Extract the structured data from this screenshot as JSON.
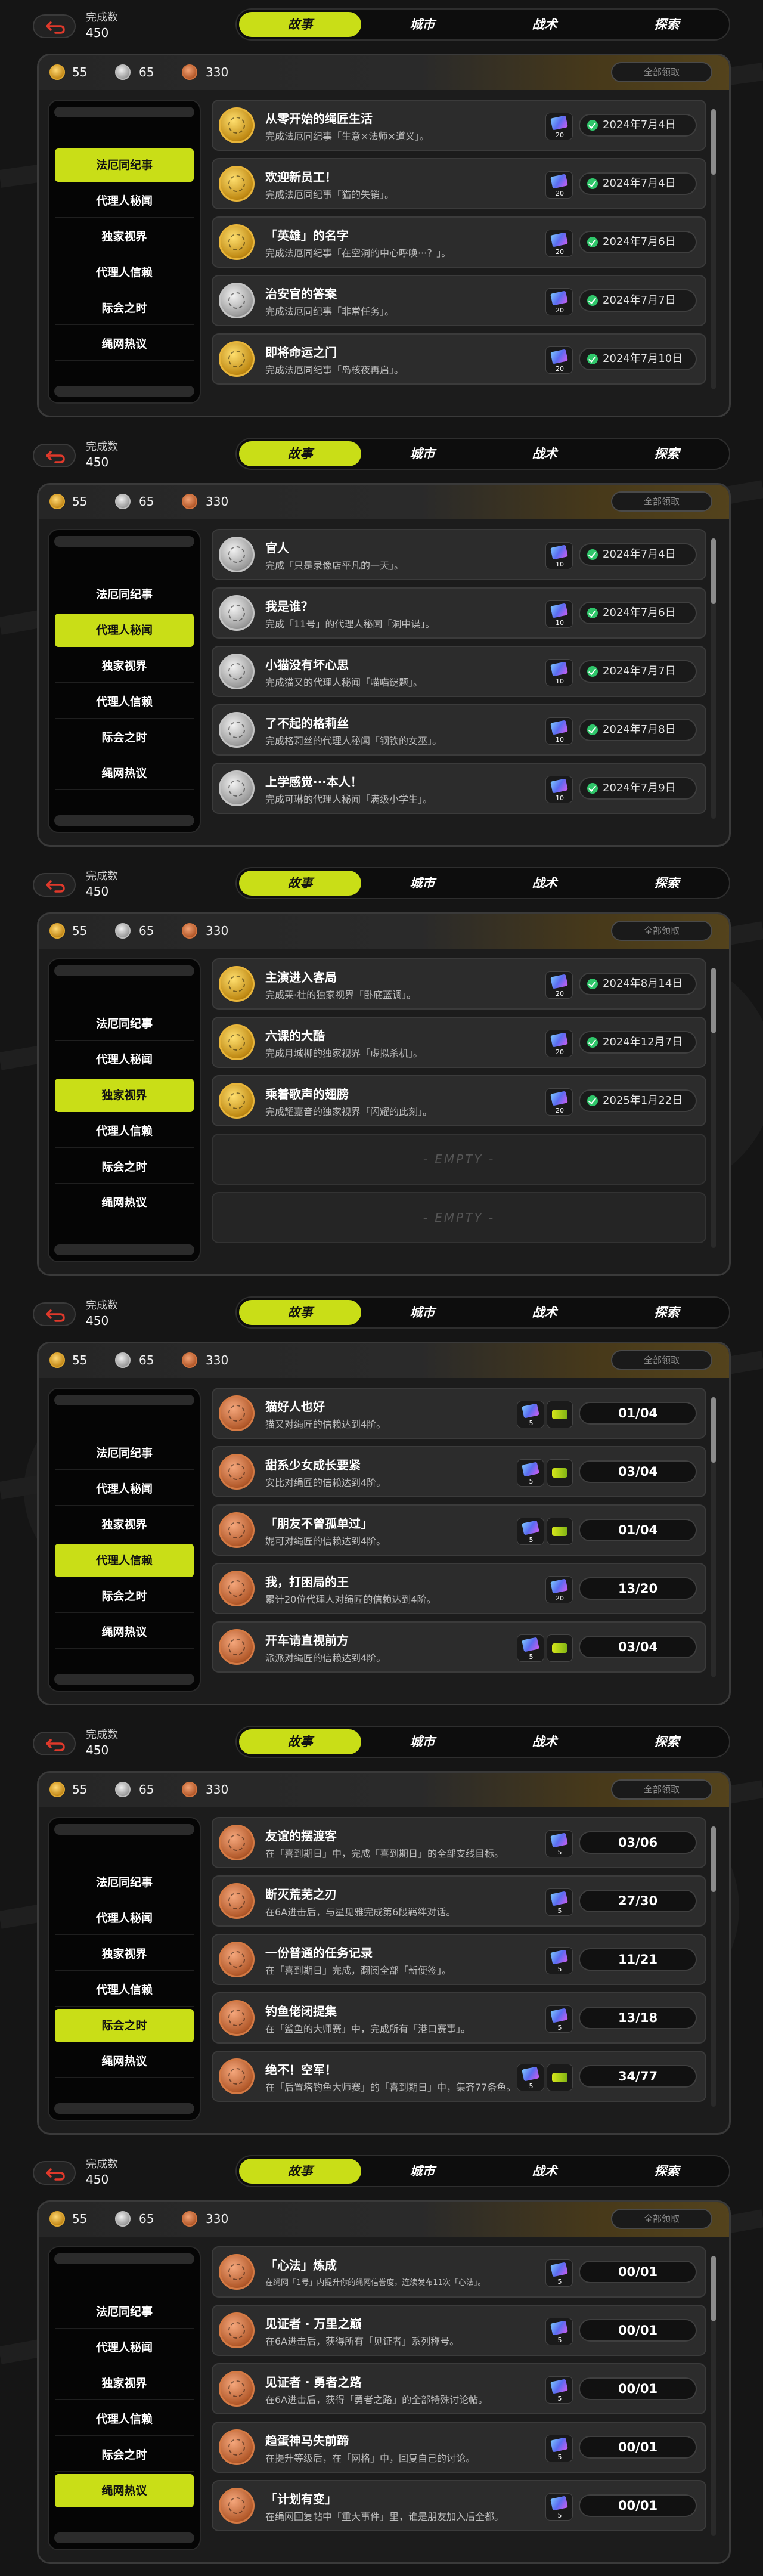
{
  "colors": {
    "accent": "#c9de17",
    "background": "#151515",
    "panel": "#1c1c1c",
    "row": "#2c2c2c",
    "check": "#2fc66a"
  },
  "icons": {
    "back": "back-arrow-icon",
    "coin_gold": "gold-coin-icon",
    "coin_silver": "silver-coin-icon",
    "coin_bronze": "bronze-coin-icon",
    "ticket": "film-ticket-icon",
    "chip": "chip-icon",
    "check": "check-icon",
    "medal": "medal-icon"
  },
  "screens": [
    {
      "count_label": "完成数",
      "count_value": "450",
      "tabs": [
        "故事",
        "城市",
        "战术",
        "探索"
      ],
      "active_tab": 0,
      "coins": {
        "gold": "55",
        "silver": "65",
        "bronze": "330"
      },
      "claim_all": "全部领取",
      "sidebar": [
        "法厄同纪事",
        "代理人秘闻",
        "独家视界",
        "代理人信赖",
        "际会之时",
        "绳网热议"
      ],
      "active_sidebar": 0,
      "rows": [
        {
          "medal": "gold",
          "title": "从零开始的绳匠生活",
          "desc": "完成法厄同纪事「生意×法师×道义」。",
          "ticket": "20",
          "chip": "",
          "status": "date",
          "value": "2024年7月4日"
        },
        {
          "medal": "gold",
          "title": "欢迎新员工！",
          "desc": "完成法厄同纪事「猫的失销」。",
          "ticket": "20",
          "chip": "",
          "status": "date",
          "value": "2024年7月4日"
        },
        {
          "medal": "gold",
          "title": "「英雄」的名字",
          "desc": "完成法厄同纪事「在空洞的中心呼唤···？」。",
          "ticket": "20",
          "chip": "",
          "status": "date",
          "value": "2024年7月6日"
        },
        {
          "medal": "silver",
          "title": "治安官的答案",
          "desc": "完成法厄同纪事「非常任务」。",
          "ticket": "20",
          "chip": "",
          "status": "date",
          "value": "2024年7月7日"
        },
        {
          "medal": "gold",
          "title": "即将命运之门",
          "desc": "完成法厄同纪事「岛核夜再启」。",
          "ticket": "20",
          "chip": "",
          "status": "date",
          "value": "2024年7月10日"
        }
      ],
      "empty": []
    },
    {
      "count_label": "完成数",
      "count_value": "450",
      "tabs": [
        "故事",
        "城市",
        "战术",
        "探索"
      ],
      "active_tab": 0,
      "coins": {
        "gold": "55",
        "silver": "65",
        "bronze": "330"
      },
      "claim_all": "全部领取",
      "sidebar": [
        "法厄同纪事",
        "代理人秘闻",
        "独家视界",
        "代理人信赖",
        "际会之时",
        "绳网热议"
      ],
      "active_sidebar": 1,
      "rows": [
        {
          "medal": "silver",
          "title": "官人",
          "desc": "完成「只是录像店平凡的一天」。",
          "ticket": "10",
          "chip": "",
          "status": "date",
          "value": "2024年7月4日"
        },
        {
          "medal": "silver",
          "title": "我是谁？",
          "desc": "完成「11号」的代理人秘闻「洞中谍」。",
          "ticket": "10",
          "chip": "",
          "status": "date",
          "value": "2024年7月6日"
        },
        {
          "medal": "silver",
          "title": "小猫没有坏心思",
          "desc": "完成猫又的代理人秘闻「喵喵谜题」。",
          "ticket": "10",
          "chip": "",
          "status": "date",
          "value": "2024年7月7日"
        },
        {
          "medal": "silver",
          "title": "了不起的格莉丝",
          "desc": "完成格莉丝的代理人秘闻「钢铁的女巫」。",
          "ticket": "10",
          "chip": "",
          "status": "date",
          "value": "2024年7月8日"
        },
        {
          "medal": "silver",
          "title": "上学感觉···本人！",
          "desc": "完成可琳的代理人秘闻「满级小学生」。",
          "ticket": "10",
          "chip": "",
          "status": "date",
          "value": "2024年7月9日"
        }
      ],
      "empty": []
    },
    {
      "count_label": "完成数",
      "count_value": "450",
      "tabs": [
        "故事",
        "城市",
        "战术",
        "探索"
      ],
      "active_tab": 0,
      "coins": {
        "gold": "55",
        "silver": "65",
        "bronze": "330"
      },
      "claim_all": "全部领取",
      "sidebar": [
        "法厄同纪事",
        "代理人秘闻",
        "独家视界",
        "代理人信赖",
        "际会之时",
        "绳网热议"
      ],
      "active_sidebar": 2,
      "rows": [
        {
          "medal": "gold",
          "title": "主演进入客局",
          "desc": "完成莱·杜的独家视界「卧底蓝调」。",
          "ticket": "20",
          "chip": "",
          "status": "date",
          "value": "2024年8月14日"
        },
        {
          "medal": "gold",
          "title": "六课的大酷",
          "desc": "完成月城柳的独家视界「虚拟杀机」。",
          "ticket": "20",
          "chip": "",
          "status": "date",
          "value": "2024年12月7日"
        },
        {
          "medal": "gold",
          "title": "乘着歌声的翅膀",
          "desc": "完成耀嘉音的独家视界「闪耀的此刻」。",
          "ticket": "20",
          "chip": "",
          "status": "date",
          "value": "2025年1月22日"
        }
      ],
      "empty": [
        "- EMPTY -",
        "- EMPTY -"
      ]
    },
    {
      "count_label": "完成数",
      "count_value": "450",
      "tabs": [
        "故事",
        "城市",
        "战术",
        "探索"
      ],
      "active_tab": 0,
      "coins": {
        "gold": "55",
        "silver": "65",
        "bronze": "330"
      },
      "claim_all": "全部领取",
      "sidebar": [
        "法厄同纪事",
        "代理人秘闻",
        "独家视界",
        "代理人信赖",
        "际会之时",
        "绳网热议"
      ],
      "active_sidebar": 3,
      "rows": [
        {
          "medal": "bronze",
          "title": "猫好人也好",
          "desc": "猫又对绳匠的信赖达到4阶。",
          "ticket": "5",
          "chip": "chip",
          "status": "progress",
          "value": "01/04"
        },
        {
          "medal": "bronze",
          "title": "甜系少女成长要紧",
          "desc": "安比对绳匠的信赖达到4阶。",
          "ticket": "5",
          "chip": "chip",
          "status": "progress",
          "value": "03/04"
        },
        {
          "medal": "bronze",
          "title": "「朋友不曾孤单过」",
          "desc": "妮可对绳匠的信赖达到4阶。",
          "ticket": "5",
          "chip": "chip",
          "status": "progress",
          "value": "01/04"
        },
        {
          "medal": "bronze",
          "title": "我，打困局的王",
          "desc": "累计20位代理人对绳匠的信赖达到4阶。",
          "ticket": "20",
          "chip": "",
          "status": "progress",
          "value": "13/20"
        },
        {
          "medal": "bronze",
          "title": "开车请直视前方",
          "desc": "派派对绳匠的信赖达到4阶。",
          "ticket": "5",
          "chip": "chip",
          "status": "progress",
          "value": "03/04"
        }
      ],
      "empty": []
    },
    {
      "count_label": "完成数",
      "count_value": "450",
      "tabs": [
        "故事",
        "城市",
        "战术",
        "探索"
      ],
      "active_tab": 0,
      "coins": {
        "gold": "55",
        "silver": "65",
        "bronze": "330"
      },
      "claim_all": "全部领取",
      "sidebar": [
        "法厄同纪事",
        "代理人秘闻",
        "独家视界",
        "代理人信赖",
        "际会之时",
        "绳网热议"
      ],
      "active_sidebar": 4,
      "rows": [
        {
          "medal": "bronze",
          "title": "友谊的摆渡客",
          "desc": "在「喜到期日」中，完成「喜到期日」的全部支线目标。",
          "ticket": "5",
          "chip": "",
          "status": "progress",
          "value": "03/06"
        },
        {
          "medal": "bronze",
          "title": "断灭荒芜之刃",
          "desc": "在6A进击后，与星见雅完成第6段羁绊对话。",
          "ticket": "5",
          "chip": "",
          "status": "progress",
          "value": "27/30"
        },
        {
          "medal": "bronze",
          "title": "一份普通的任务记录",
          "desc": "在「喜到期日」完成，翻阅全部「新便签」。",
          "ticket": "5",
          "chip": "",
          "status": "progress",
          "value": "11/21"
        },
        {
          "medal": "bronze",
          "title": "钓鱼佬闭提集",
          "desc": "在「鲨鱼的大师赛」中，完成所有「港口赛事」。",
          "ticket": "5",
          "chip": "",
          "status": "progress",
          "value": "13/18"
        },
        {
          "medal": "bronze",
          "title": "绝不！空军！",
          "desc": "在「后置塔钓鱼大师赛」的「喜到期日」中，集齐77条鱼。",
          "ticket": "5",
          "chip": "chip",
          "status": "progress",
          "value": "34/77"
        }
      ],
      "empty": []
    },
    {
      "count_label": "完成数",
      "count_value": "450",
      "tabs": [
        "故事",
        "城市",
        "战术",
        "探索"
      ],
      "active_tab": 0,
      "coins": {
        "gold": "55",
        "silver": "65",
        "bronze": "330"
      },
      "claim_all": "全部领取",
      "sidebar": [
        "法厄同纪事",
        "代理人秘闻",
        "独家视界",
        "代理人信赖",
        "际会之时",
        "绳网热议"
      ],
      "active_sidebar": 5,
      "rows": [
        {
          "medal": "bronze",
          "title": "「心法」炼成",
          "desc": "在绳网「1号」内提升你的绳网信誉度，连续发布11次「心法」。",
          "ticket": "5",
          "chip": "",
          "status": "progress",
          "value": "00/01"
        },
        {
          "medal": "bronze",
          "title": "见证者 · 万里之巅",
          "desc": "在6A进击后，获得所有「见证者」系列称号。",
          "ticket": "5",
          "chip": "",
          "status": "progress",
          "value": "00/01"
        },
        {
          "medal": "bronze",
          "title": "见证者 · 勇者之路",
          "desc": "在6A进击后，获得「勇者之路」的全部特殊讨论帖。",
          "ticket": "5",
          "chip": "",
          "status": "progress",
          "value": "00/01"
        },
        {
          "medal": "bronze",
          "title": "趋蛋神马失前蹄",
          "desc": "在提升等级后，在「网格」中，回复自己的讨论。",
          "ticket": "5",
          "chip": "",
          "status": "progress",
          "value": "00/01"
        },
        {
          "medal": "bronze",
          "title": "「计划有变」",
          "desc": "在绳网回复帖中「重大事件」里，谁是朋友加入后全都。",
          "ticket": "5",
          "chip": "",
          "status": "progress",
          "value": "00/01"
        }
      ],
      "empty": []
    }
  ]
}
